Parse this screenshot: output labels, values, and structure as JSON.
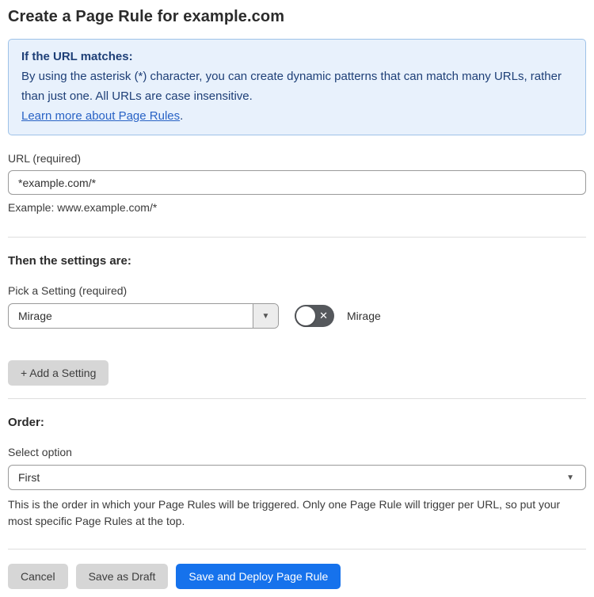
{
  "page": {
    "title": "Create a Page Rule for example.com"
  },
  "info_box": {
    "heading": "If the URL matches:",
    "body": "By using the asterisk (*) character, you can create dynamic patterns that can match many URLs, rather than just one. All URLs are case insensitive.",
    "link_label": "Learn more about Page Rules",
    "link_suffix": "."
  },
  "url_field": {
    "label": "URL (required)",
    "value": "*example.com/*",
    "helper": "Example: www.example.com/*"
  },
  "settings_section": {
    "heading": "Then the settings are:",
    "picker_label": "Pick a Setting (required)",
    "picker_value": "Mirage",
    "picker_arrow": "▼",
    "toggle_state": "off",
    "toggle_glyph": "✕",
    "toggle_label": "Mirage",
    "add_button_label": "+ Add a Setting"
  },
  "order_section": {
    "heading": "Order:",
    "select_label": "Select option",
    "select_value": "First",
    "select_arrow": "▼",
    "helper": "This is the order in which your Page Rules will be triggered. Only one Page Rule will trigger per URL, so put your most specific Page Rules at the top."
  },
  "actions": {
    "cancel_label": "Cancel",
    "save_draft_label": "Save as Draft",
    "save_deploy_label": "Save and Deploy Page Rule"
  },
  "colors": {
    "info_bg": "#e8f1fc",
    "info_border": "#9ec2e8",
    "info_text": "#1e3f77",
    "link": "#2862c5",
    "primary_button": "#1672ec",
    "gray_button": "#d6d6d6",
    "toggle_off_bg": "#55585c"
  }
}
